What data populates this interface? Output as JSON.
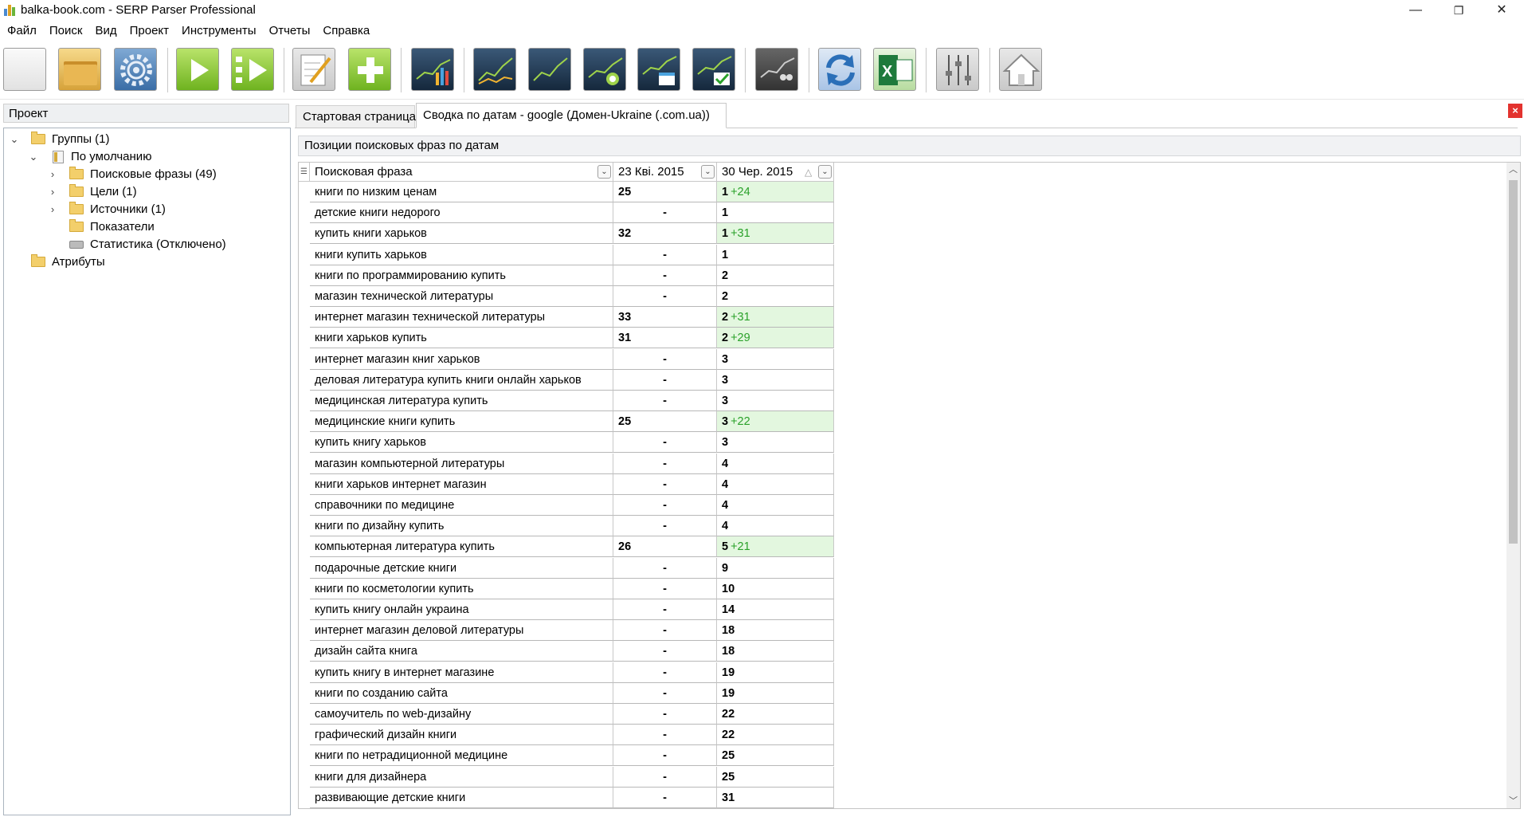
{
  "window": {
    "title": "balka-book.com - SERP Parser Professional",
    "minimize": "—",
    "maximize": "❐",
    "close": "✕"
  },
  "menu": [
    "Файл",
    "Поиск",
    "Вид",
    "Проект",
    "Инструменты",
    "Отчеты",
    "Справка"
  ],
  "toolbar": {
    "icons": [
      "new-project-icon",
      "open-folder-icon",
      "settings-gear-icon",
      "play-icon",
      "play-checklist-icon",
      "edit-notepad-icon",
      "add-plus-icon",
      "chart-bars-icon",
      "chart-line-icon",
      "chart-growth-icon",
      "chart-target-icon",
      "chart-calendar-icon",
      "chart-check-icon",
      "chart-users-icon",
      "refresh-icon",
      "excel-export-icon",
      "sliders-icon",
      "home-icon"
    ]
  },
  "left_panel": {
    "header": "Проект",
    "tree": [
      {
        "label": "Группы (1)",
        "expanded": true,
        "level": 0,
        "type": "folder"
      },
      {
        "label": "По умолчанию",
        "expanded": true,
        "level": 1,
        "type": "book"
      },
      {
        "label": "Поисковые фразы (49)",
        "expanded": false,
        "level": 2,
        "type": "folder"
      },
      {
        "label": "Цели (1)",
        "expanded": false,
        "level": 2,
        "type": "folder"
      },
      {
        "label": "Источники (1)",
        "expanded": false,
        "level": 2,
        "type": "folder"
      },
      {
        "label": "Показатели",
        "level": 2,
        "type": "folder"
      },
      {
        "label": "Статистика (Отключено)",
        "level": 2,
        "type": "stats"
      },
      {
        "label": "Атрибуты",
        "level": 0,
        "type": "folder"
      }
    ]
  },
  "tabs": [
    {
      "label": "Стартовая страница",
      "active": false
    },
    {
      "label": "Сводка по датам - google (Домен-Ukraine (.com.ua))",
      "active": true
    }
  ],
  "close_tab": "×",
  "section_title": "Позиции поисковых фраз по датам",
  "grid": {
    "columns": [
      "Поисковая фраза",
      "23 Кві. 2015",
      "30 Чер. 2015"
    ],
    "sort_indicator": "△",
    "rows": [
      {
        "phrase": "книги по низким ценам",
        "d1": "25",
        "d2": "1",
        "delta": "+24"
      },
      {
        "phrase": "детские книги недорого",
        "d1": "-",
        "d2": "1",
        "delta": ""
      },
      {
        "phrase": "купить книги харьков",
        "d1": "32",
        "d2": "1",
        "delta": "+31"
      },
      {
        "phrase": "книги купить харьков",
        "d1": "-",
        "d2": "1",
        "delta": ""
      },
      {
        "phrase": "книги по программированию купить",
        "d1": "-",
        "d2": "2",
        "delta": ""
      },
      {
        "phrase": "магазин технической литературы",
        "d1": "-",
        "d2": "2",
        "delta": ""
      },
      {
        "phrase": "интернет магазин технической литературы",
        "d1": "33",
        "d2": "2",
        "delta": "+31"
      },
      {
        "phrase": "книги харьков купить",
        "d1": "31",
        "d2": "2",
        "delta": "+29"
      },
      {
        "phrase": "интернет магазин книг харьков",
        "d1": "-",
        "d2": "3",
        "delta": ""
      },
      {
        "phrase": "деловая литература купить книги онлайн харьков",
        "d1": "-",
        "d2": "3",
        "delta": ""
      },
      {
        "phrase": "медицинская литература купить",
        "d1": "-",
        "d2": "3",
        "delta": ""
      },
      {
        "phrase": "медицинские книги купить",
        "d1": "25",
        "d2": "3",
        "delta": "+22"
      },
      {
        "phrase": "купить книгу харьков",
        "d1": "-",
        "d2": "3",
        "delta": ""
      },
      {
        "phrase": "магазин компьютерной литературы",
        "d1": "-",
        "d2": "4",
        "delta": ""
      },
      {
        "phrase": "книги харьков интернет магазин",
        "d1": "-",
        "d2": "4",
        "delta": ""
      },
      {
        "phrase": "справочники по медицине",
        "d1": "-",
        "d2": "4",
        "delta": ""
      },
      {
        "phrase": "книги по дизайну купить",
        "d1": "-",
        "d2": "4",
        "delta": ""
      },
      {
        "phrase": "компьютерная литература купить",
        "d1": "26",
        "d2": "5",
        "delta": "+21"
      },
      {
        "phrase": "подарочные детские книги",
        "d1": "-",
        "d2": "9",
        "delta": ""
      },
      {
        "phrase": "книги по косметологии купить",
        "d1": "-",
        "d2": "10",
        "delta": ""
      },
      {
        "phrase": "купить книгу онлайн украина",
        "d1": "-",
        "d2": "14",
        "delta": ""
      },
      {
        "phrase": "интернет магазин деловой литературы",
        "d1": "-",
        "d2": "18",
        "delta": ""
      },
      {
        "phrase": "дизайн сайта книга",
        "d1": "-",
        "d2": "18",
        "delta": ""
      },
      {
        "phrase": "купить книгу в интернет магазине",
        "d1": "-",
        "d2": "19",
        "delta": ""
      },
      {
        "phrase": "книги по созданию сайта",
        "d1": "-",
        "d2": "19",
        "delta": ""
      },
      {
        "phrase": "самоучитель по web-дизайну",
        "d1": "-",
        "d2": "22",
        "delta": ""
      },
      {
        "phrase": "графический дизайн книги",
        "d1": "-",
        "d2": "22",
        "delta": ""
      },
      {
        "phrase": "книги по нетрадиционной медицине",
        "d1": "-",
        "d2": "25",
        "delta": ""
      },
      {
        "phrase": "книги для дизайнера",
        "d1": "-",
        "d2": "25",
        "delta": ""
      },
      {
        "phrase": "развивающие детские книги",
        "d1": "-",
        "d2": "31",
        "delta": ""
      }
    ]
  },
  "colors": {
    "improved_bg": "#e3f7df",
    "delta_text": "#2aa12a",
    "close_tab_bg": "#e3332f"
  }
}
